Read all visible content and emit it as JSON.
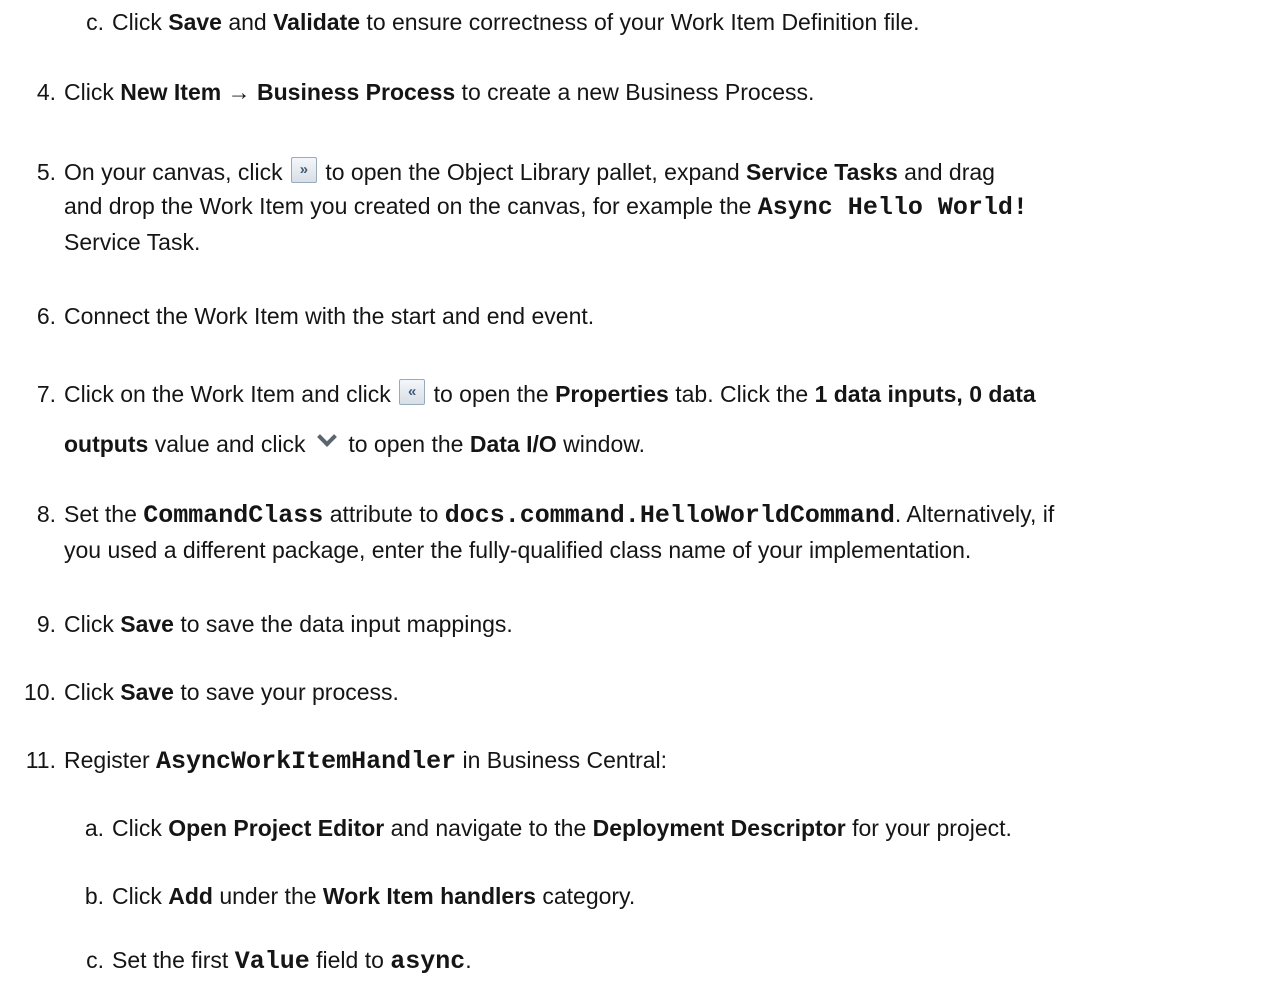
{
  "steps": {
    "c1": {
      "marker": "c.",
      "t1": "Click ",
      "b1": "Save",
      "t2": " and ",
      "b2": "Validate",
      "t3": " to ensure correctness of your Work Item Definition file."
    },
    "s4": {
      "marker": "4.",
      "t1": "Click ",
      "b1": "New Item",
      "t2": " → ",
      "b2": "Business Process",
      "t3": " to create a new Business Process."
    },
    "s5": {
      "marker": "5.",
      "t1": "On your canvas, click ",
      "icon": "»",
      "t2": " to open the Object Library pallet, expand ",
      "b1": "Service Tasks",
      "t3": " and drag",
      "t4": "and drop the Work Item you created on the canvas, for example the ",
      "m1": "Async Hello World!",
      "t5": "Service Task."
    },
    "s6": {
      "marker": "6.",
      "t1": "Connect the Work Item with the start and end event."
    },
    "s7": {
      "marker": "7.",
      "t1": "Click on the Work Item and click ",
      "icon": "«",
      "t2": " to open the ",
      "b1": "Properties",
      "t3": " tab. Click the ",
      "b2": "1 data inputs, 0 data",
      "b3": "outputs",
      "t4": " value and click ",
      "t5": " to open the ",
      "b4": "Data I/O",
      "t6": " window."
    },
    "s8": {
      "marker": "8.",
      "t1": "Set the ",
      "m1": "CommandClass",
      "t2": " attribute to ",
      "m2": "docs.command.HelloWorldCommand",
      "t3": ". Alternatively, if",
      "t4": "you used a different package, enter the fully-qualified class name of your implementation."
    },
    "s9": {
      "marker": "9.",
      "t1": "Click ",
      "b1": "Save",
      "t2": " to save the data input mappings."
    },
    "s10": {
      "marker": "10.",
      "t1": "Click ",
      "b1": "Save",
      "t2": " to save your process."
    },
    "s11": {
      "marker": "11.",
      "t1": "Register ",
      "m1": "AsyncWorkItemHandler",
      "t2": " in Business Central:"
    },
    "a": {
      "marker": "a.",
      "t1": "Click ",
      "b1": "Open Project Editor",
      "t2": " and navigate to the ",
      "b2": "Deployment Descriptor",
      "t3": " for your project."
    },
    "b": {
      "marker": "b.",
      "t1": "Click ",
      "b1": "Add",
      "t2": " under the ",
      "b2": "Work Item handlers",
      "t3": " category."
    },
    "c2": {
      "marker": "c.",
      "t1": "Set the first ",
      "m1": "Value",
      "t2": " field to ",
      "m2": "async",
      "t3": "."
    }
  }
}
